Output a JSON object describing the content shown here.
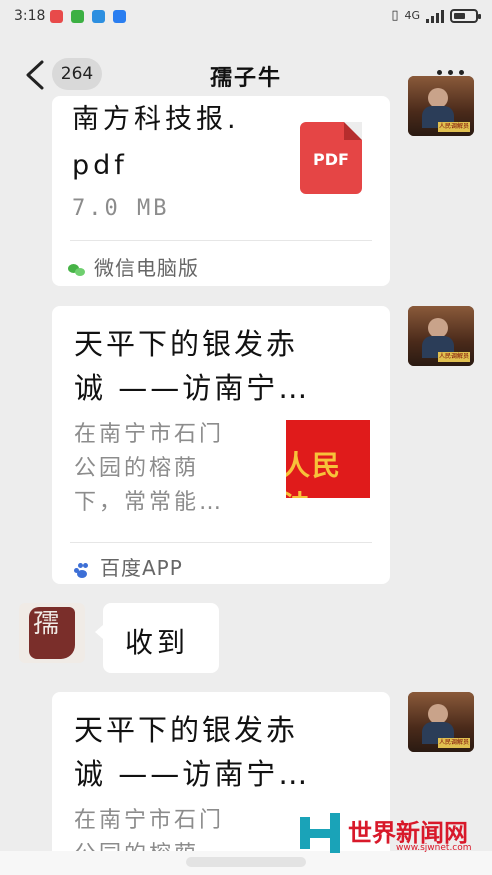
{
  "status_bar": {
    "time": "3:18",
    "network": "4G"
  },
  "nav": {
    "unread_count": "264",
    "title": "孺子牛"
  },
  "messages": {
    "file_card": {
      "filename_line1": "南方科技报.",
      "filename_line2": "pdf",
      "size": "7.0 MB",
      "file_type": "PDF",
      "source": "微信电脑版"
    },
    "article_1": {
      "title_line1": "天平下的银发赤",
      "title_line2": "诚 ——访南宁…",
      "desc_line1": "在南宁市石门",
      "desc_line2": "公园的榕荫",
      "desc_line3": "下，常常能…",
      "thumb_text": "人民法",
      "source": "百度APP"
    },
    "reply": {
      "text": "收到"
    },
    "article_2": {
      "title_line1": "天平下的银发赤",
      "title_line2": "诚 ——访南宁…",
      "desc_line1": "在南宁市石门",
      "desc_line2": "公园的榕荫"
    },
    "avatar_plate": "人民调解员"
  },
  "watermark": {
    "name": "世界新闻网",
    "url": "www.sjwnet.com"
  },
  "colors": {
    "background": "#ededed",
    "pdf_red": "#e54545",
    "wechat_green": "#47b347",
    "baidu_blue": "#3d6fd6"
  }
}
